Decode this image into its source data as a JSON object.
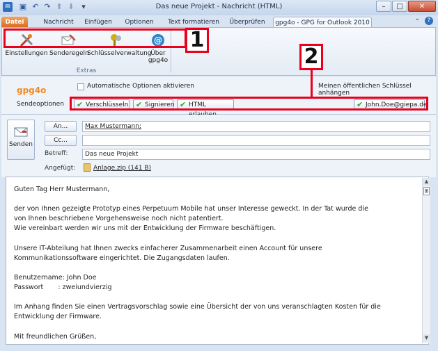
{
  "window": {
    "title": "Das neue Projekt - Nachricht (HTML)"
  },
  "qat": {
    "save_icon": "save-icon",
    "undo_icon": "undo-icon",
    "redo_icon": "redo-icon"
  },
  "tabs": {
    "file": "Datei",
    "items": [
      "Nachricht",
      "Einfügen",
      "Optionen",
      "Text formatieren",
      "Überprüfen"
    ],
    "active": "gpg4o - GPG for Outlook 2010"
  },
  "ribbon": {
    "buttons": [
      {
        "label": "Einstellungen",
        "icon": "settings-tools-icon"
      },
      {
        "label": "Senderegeln",
        "icon": "send-rules-icon"
      },
      {
        "label": "Schlüsselverwaltung",
        "icon": "keys-icon"
      },
      {
        "label": "Über",
        "label2": "gpg4o",
        "icon": "about-icon"
      }
    ],
    "group_name": "Extras"
  },
  "callouts": {
    "one": "1",
    "two": "2"
  },
  "gpg": {
    "logo": "gpg4o",
    "send_options": "Sendeoptionen",
    "auto_options": "Automatische Optionen aktivieren",
    "attach_key": "Meinen öffentlichen Schlüssel anhängen",
    "encrypt": "Verschlüsseln",
    "sign": "Signieren",
    "allow_html": "HTML erlauben",
    "sender": "John.Doe@giepa.de"
  },
  "header": {
    "send": "Senden",
    "to_button": "An...",
    "to_value": "Max Mustermann;",
    "cc_button": "Cc...",
    "cc_value": "",
    "subject_label": "Betreff:",
    "subject_value": "Das neue Projekt",
    "attached_label": "Angefügt:",
    "attachment": "Anlage.zip (141 B)"
  },
  "body": {
    "lines": [
      "Guten Tag Herr Mustermann,",
      "",
      "der von Ihnen gezeigte Prototyp eines Perpetuum Mobile hat unser Interesse geweckt. In der Tat wurde die",
      "von Ihnen beschriebene Vorgehensweise noch nicht patentiert.",
      "Wie vereinbart werden wir uns mit der Entwicklung der Firmware beschäftigen.",
      "",
      "Unsere IT-Abteilung hat Ihnen zwecks einfacherer Zusammenarbeit einen Account für unsere",
      "Kommunikationssoftware eingerichtet. Die Zugangsdaten laufen.",
      "",
      "Benutzername: John Doe",
      "Passwort       : zweiundvierzig",
      "",
      "Im Anhang finden Sie einen Vertragsvorschlag sowie eine Übersicht der von uns veranschlagten Kosten für die",
      "Entwicklung der Firmware.",
      "",
      "Mit freundlichen Grüßen,"
    ]
  }
}
